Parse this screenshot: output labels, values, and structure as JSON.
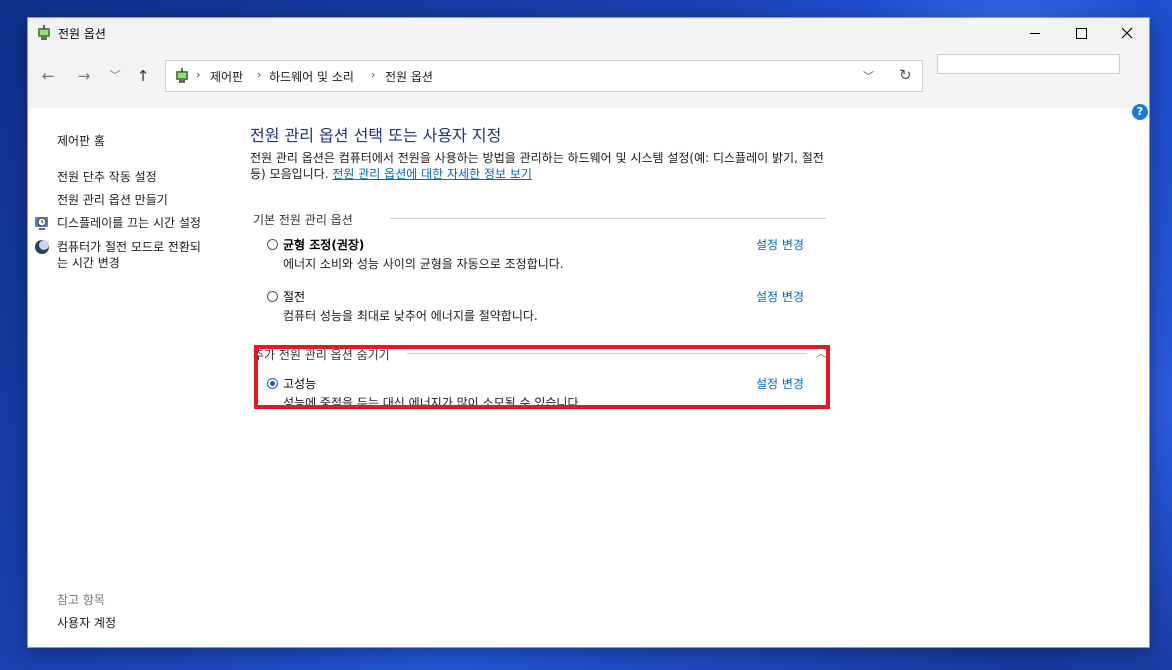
{
  "window": {
    "title": "전원 옵션"
  },
  "address": {
    "crumbs": [
      "제어판",
      "하드웨어 및 소리",
      "전원 옵션"
    ],
    "search_placeholder": ""
  },
  "sidebar": {
    "home": "제어판 홈",
    "links": [
      "전원 단추 작동 설정",
      "전원 관리 옵션 만들기",
      "디스플레이를 끄는 시간 설정",
      "컴퓨터가 절전 모드로 전환되는 시간 변경"
    ],
    "link4_line1": "컴퓨터가 절전 모드로 전환되",
    "link4_line2": "는 시간 변경",
    "see_also": "참고 항목",
    "user_accounts": "사용자 계정"
  },
  "main": {
    "title": "전원 관리 옵션 선택 또는 사용자 지정",
    "intro_text": "전원 관리 옵션은 컴퓨터에서 전원을 사용하는 방법을 관리하는 하드웨어 및 시스템 설정(예: 디스플레이 밝기, 절전 등) 모음입니다. ",
    "intro_link": "전원 관리 옵션에 대한 자세한 정보 보기",
    "preferred_head": "기본 전원 관리 옵션",
    "additional_head": "추가 전원 관리 옵션 숨기기",
    "change_label": "설정 변경",
    "plans": [
      {
        "name": "균형 조정(권장)",
        "desc": "에너지 소비와 성능 사이의 균형을 자동으로 조정합니다.",
        "selected": false
      },
      {
        "name": "절전",
        "desc": "컴퓨터 성능을 최대로 낮추어 에너지를 절약합니다.",
        "selected": false
      },
      {
        "name": "고성능",
        "desc": "성능에 중점을 두는 대신 에너지가 많이 소모될 수 있습니다.",
        "selected": true
      }
    ]
  },
  "colors": {
    "accent": "#0066cc",
    "title": "#1e3287",
    "highlight": "#e01b24"
  }
}
